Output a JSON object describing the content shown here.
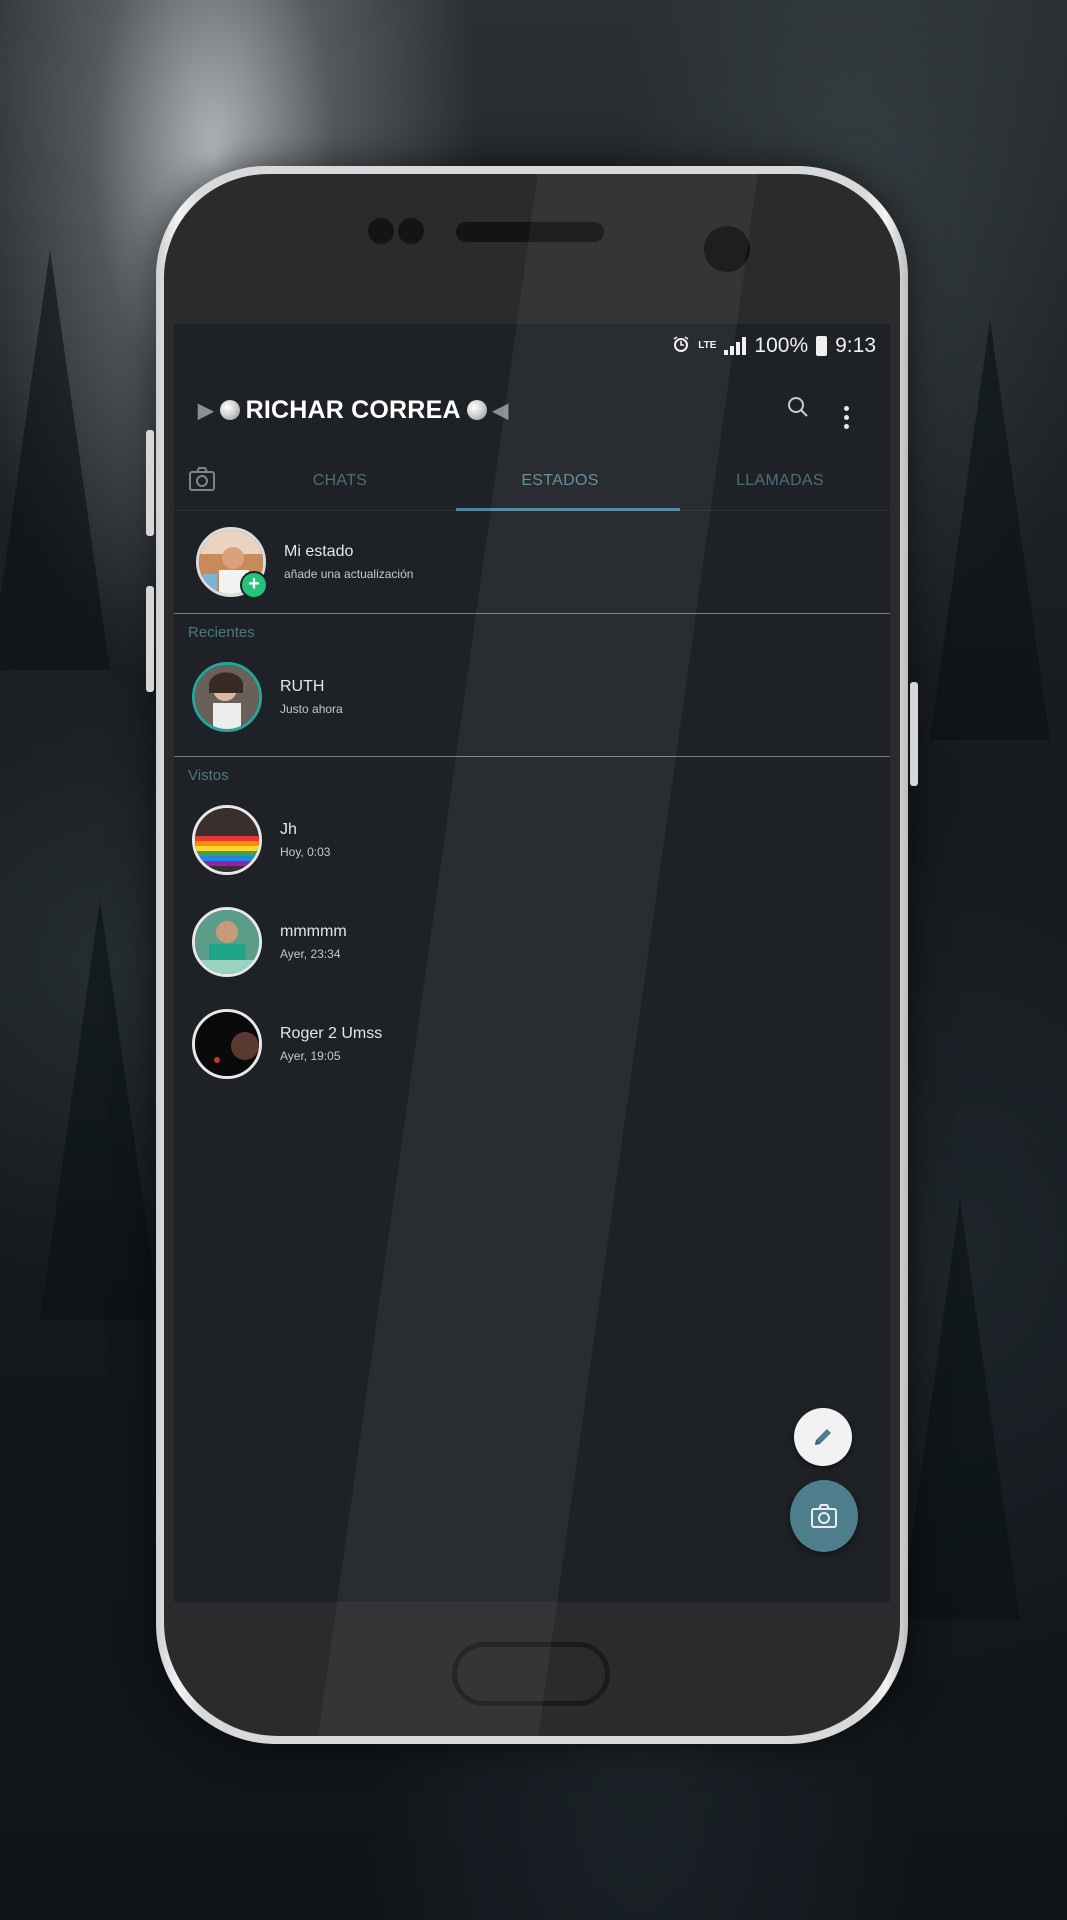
{
  "statusbar": {
    "network": "LTE",
    "battery": "100%",
    "time": "9:13"
  },
  "appbar": {
    "title": "RICHAR CORREA"
  },
  "tabs": [
    {
      "label": "CHATS"
    },
    {
      "label": "ESTADOS"
    },
    {
      "label": "LLAMADAS"
    }
  ],
  "my_status": {
    "title": "Mi estado",
    "subtitle": "añade una actualización"
  },
  "sections": {
    "recent": "Recientes",
    "viewed": "Vistos"
  },
  "recent": [
    {
      "name": "RUTH",
      "time": "Justo ahora"
    }
  ],
  "viewed": [
    {
      "name": "Jh",
      "time": "Hoy, 0:03"
    },
    {
      "name": "mmmmm",
      "time": "Ayer, 23:34"
    },
    {
      "name": "Roger 2 Umss",
      "time": "Ayer, 19:05"
    }
  ],
  "icons": {
    "alarm": "alarm-icon",
    "signal": "signal-icon",
    "battery": "battery-icon",
    "search": "search-icon",
    "menu": "more-vert-icon",
    "camera": "camera-icon",
    "pencil": "pencil-icon",
    "add": "add-icon"
  },
  "colors": {
    "accent": "#4e8696",
    "fab_camera": "#4e7d8c",
    "add_badge": "#25c27a",
    "screen_bg": "#1e2126"
  }
}
